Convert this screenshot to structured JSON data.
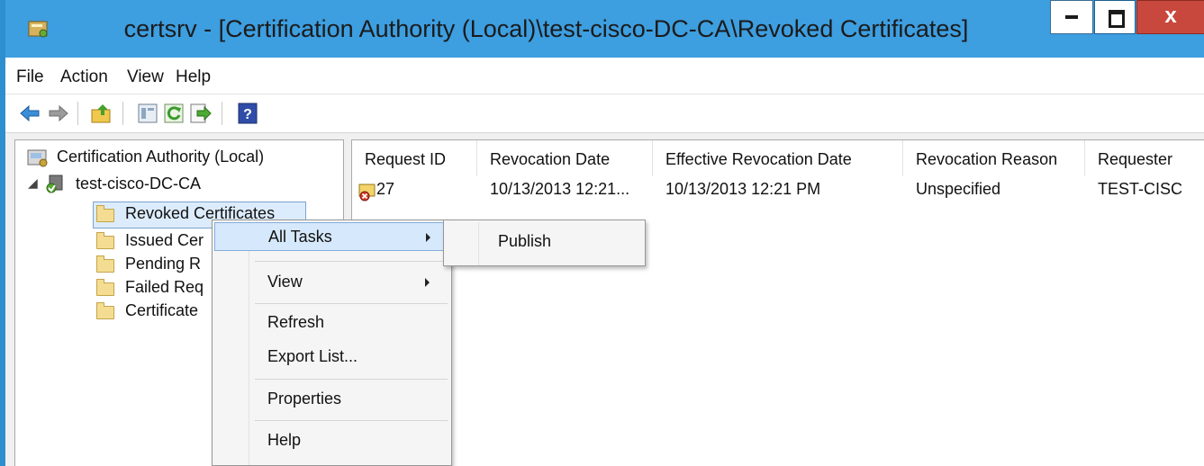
{
  "window": {
    "title": "certsrv - [Certification Authority (Local)\\test-cisco-DC-CA\\Revoked Certificates]",
    "min_label": "–",
    "close_label": "x"
  },
  "menubar": {
    "items": [
      "File",
      "Action",
      "View",
      "Help"
    ]
  },
  "toolbar": {
    "icons": [
      "back-arrow-icon",
      "forward-arrow-icon",
      "up-folder-icon",
      "show-hide-tree-icon",
      "refresh-icon",
      "export-list-icon",
      "help-icon"
    ]
  },
  "tree": {
    "root": "Certification Authority (Local)",
    "ca": "test-cisco-DC-CA",
    "expand_glyph": "◢",
    "items": [
      "Revoked Certificates",
      "Issued Cer",
      "Pending R",
      "Failed Req",
      "Certificate"
    ]
  },
  "list": {
    "columns": [
      "Request ID",
      "Revocation Date",
      "Effective Revocation Date",
      "Revocation Reason",
      "Requester"
    ],
    "rows": [
      {
        "request_id": "27",
        "revocation_date": "10/13/2013 12:21...",
        "effective_date": "10/13/2013 12:21 PM",
        "reason": "Unspecified",
        "requester": "TEST-CISC"
      }
    ]
  },
  "context_menu": {
    "items": [
      "All Tasks",
      "View",
      "Refresh",
      "Export List...",
      "Properties",
      "Help"
    ]
  },
  "submenu": {
    "items": [
      "Publish"
    ]
  },
  "colors": {
    "titlebar": "#3d9ee0",
    "close": "#c9483d",
    "highlight": "#d6e8fb"
  }
}
